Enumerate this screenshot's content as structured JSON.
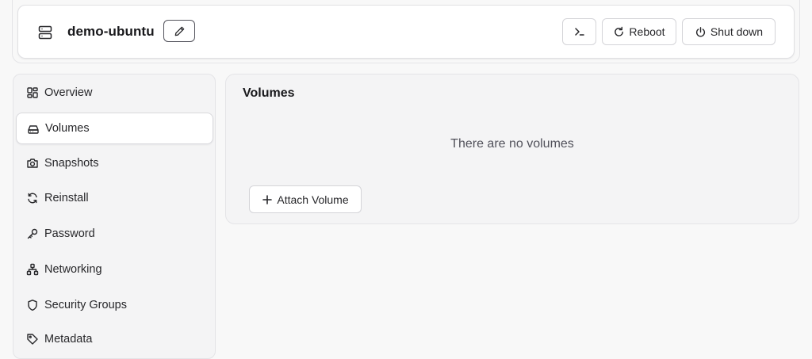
{
  "header": {
    "server_name": "demo-ubuntu",
    "reboot_label": "Reboot",
    "shutdown_label": "Shut down"
  },
  "sidebar": {
    "items": [
      {
        "label": "Overview",
        "icon": "overview-icon"
      },
      {
        "label": "Volumes",
        "icon": "drive-icon",
        "active": true
      },
      {
        "label": "Snapshots",
        "icon": "camera-icon"
      },
      {
        "label": "Reinstall",
        "icon": "refresh-icon"
      },
      {
        "label": "Password",
        "icon": "key-icon"
      },
      {
        "label": "Networking",
        "icon": "network-icon"
      },
      {
        "label": "Security Groups",
        "icon": "shield-icon"
      },
      {
        "label": "Metadata",
        "icon": "tag-icon"
      }
    ]
  },
  "main": {
    "title": "Volumes",
    "empty_message": "There are no volumes",
    "attach_label": "Attach Volume"
  }
}
